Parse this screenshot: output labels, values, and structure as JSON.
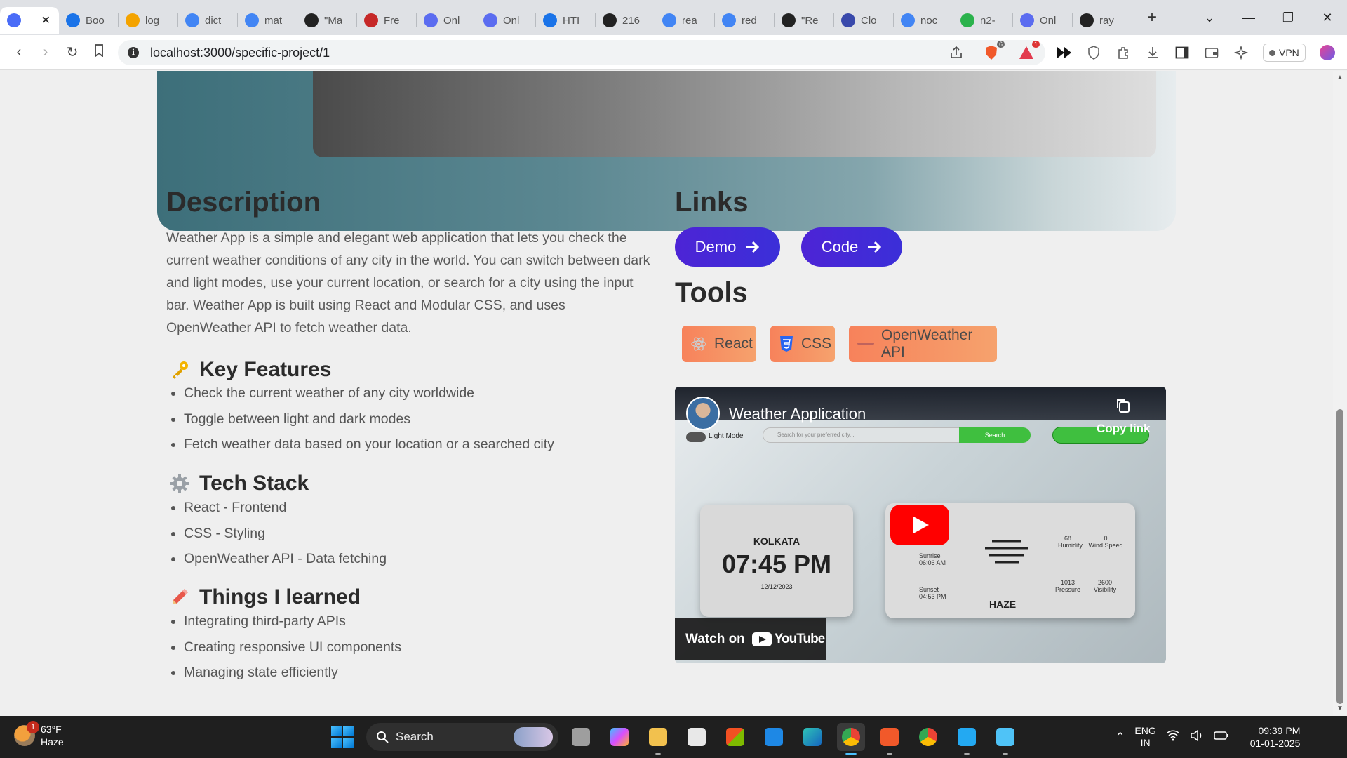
{
  "browser": {
    "tabs": [
      {
        "label": "",
        "favicon": "blog-favicon",
        "color": "#4a6cf7",
        "active": true
      },
      {
        "label": "Boo",
        "favicon": "bookmark-flag-icon",
        "color": "#1a73e8"
      },
      {
        "label": "log",
        "favicon": "flame-icon",
        "color": "#f4a300"
      },
      {
        "label": "dict",
        "favicon": "google-icon",
        "color": "#4285f4"
      },
      {
        "label": "mat",
        "favicon": "google-icon",
        "color": "#4285f4"
      },
      {
        "label": "\"Ma",
        "favicon": "penguin-icon",
        "color": "#222222"
      },
      {
        "label": "Fre",
        "favicon": "book-icon",
        "color": "#c62828"
      },
      {
        "label": "Onl",
        "favicon": "copilot-icon",
        "color": "#5b6cf0"
      },
      {
        "label": "Onl",
        "favicon": "copilot-icon",
        "color": "#5b6cf0"
      },
      {
        "label": "HTI",
        "favicon": "flag-icon",
        "color": "#1a73e8"
      },
      {
        "label": "216",
        "favicon": "penguin-icon",
        "color": "#222222"
      },
      {
        "label": "rea",
        "favicon": "google-icon",
        "color": "#4285f4"
      },
      {
        "label": "red",
        "favicon": "google-icon",
        "color": "#4285f4"
      },
      {
        "label": "\"Re",
        "favicon": "penguin-icon",
        "color": "#222222"
      },
      {
        "label": "Clo",
        "favicon": "cloud-icon",
        "color": "#3949ab"
      },
      {
        "label": "noc",
        "favicon": "google-icon",
        "color": "#4285f4"
      },
      {
        "label": "n2-",
        "favicon": "bolt-icon",
        "color": "#2bb24c"
      },
      {
        "label": "Onl",
        "favicon": "copilot-icon",
        "color": "#5b6cf0"
      },
      {
        "label": "ray",
        "favicon": "github-icon",
        "color": "#222222"
      }
    ],
    "url": "localhost:3000/specific-project/1",
    "brave_badge": "6",
    "alert_badge": "1",
    "vpn_label": "VPN"
  },
  "project": {
    "description_title": "Description",
    "description_text": "Weather App is a simple and elegant web application that lets you check the current weather conditions of any city in the world. You can switch between dark and light modes, use your current location, or search for a city using the input bar. Weather App is built using React and Modular CSS, and uses OpenWeather API to fetch weather data.",
    "key_features_title": "Key Features",
    "key_features": [
      "Check the current weather of any city worldwide",
      "Toggle between light and dark modes",
      "Fetch weather data based on your location or a searched city"
    ],
    "tech_stack_title": "Tech Stack",
    "tech_stack": [
      "React - Frontend",
      "CSS - Styling",
      "OpenWeather API - Data fetching"
    ],
    "learned_title": "Things I learned",
    "learned": [
      "Integrating third-party APIs",
      "Creating responsive UI components",
      "Managing state efficiently"
    ],
    "links_title": "Links",
    "demo_label": "Demo",
    "code_label": "Code",
    "tools_title": "Tools",
    "tools": [
      "React",
      "CSS",
      "OpenWeather API"
    ]
  },
  "video": {
    "title": "Weather Application",
    "copy_link": "Copy link",
    "search_placeholder": "Search for your preferred city...",
    "search_button": "Search",
    "light_mode": "Light Mode",
    "city": "KOLKATA",
    "time": "07:45 PM",
    "date": "12/12/2023",
    "sunrise_label": "Sunrise",
    "sunrise_time": "06:06 AM",
    "sunset_label": "Sunset",
    "sunset_time": "04:53 PM",
    "condition": "HAZE",
    "humidity_value": "68",
    "humidity_label": "Humidity",
    "wind_value": "0",
    "wind_label": "Wind Speed",
    "pressure_value": "1013",
    "pressure_label": "Pressure",
    "visibility_value": "2600",
    "visibility_label": "Visibility",
    "watch_on": "Watch on",
    "youtube": "YouTube"
  },
  "taskbar": {
    "temperature": "63°F",
    "condition": "Haze",
    "weather_badge": "1",
    "search_label": "Search",
    "lang_top": "ENG",
    "lang_bottom": "IN",
    "time": "09:39 PM",
    "date": "01-01-2025"
  }
}
